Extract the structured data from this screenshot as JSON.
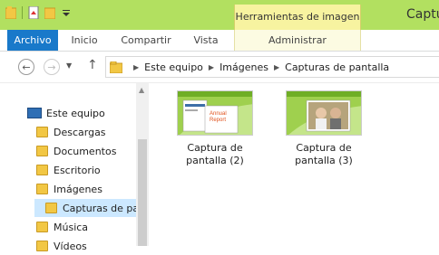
{
  "window": {
    "title": "Captu"
  },
  "quick_access": {
    "icons": [
      "folder-icon",
      "properties-icon",
      "new-folder-icon",
      "customize-dropdown-icon"
    ]
  },
  "ribbon": {
    "contextual_label": "Herramientas de imagen",
    "tabs": [
      {
        "label": "Archivo",
        "active": true
      },
      {
        "label": "Inicio"
      },
      {
        "label": "Compartir"
      },
      {
        "label": "Vista"
      },
      {
        "label": "Administrar"
      }
    ]
  },
  "address": {
    "crumbs": [
      "Este equipo",
      "Imágenes",
      "Capturas de pantalla"
    ]
  },
  "sidebar": {
    "items": [
      {
        "label": "Este equipo",
        "icon": "computer-icon"
      },
      {
        "label": "Descargas",
        "icon": "folder-icon"
      },
      {
        "label": "Documentos",
        "icon": "folder-icon"
      },
      {
        "label": "Escritorio",
        "icon": "folder-icon"
      },
      {
        "label": "Imágenes",
        "icon": "folder-icon"
      },
      {
        "label": "Capturas de pa",
        "icon": "folder-icon",
        "selected": true
      },
      {
        "label": "Música",
        "icon": "folder-icon"
      },
      {
        "label": "Vídeos",
        "icon": "folder-icon"
      }
    ]
  },
  "files": [
    {
      "name_line1": "Captura de",
      "name_line2": "pantalla (2)",
      "thumb_text": [
        "Annual",
        "Report"
      ]
    },
    {
      "name_line1": "Captura de",
      "name_line2": "pantalla (3)"
    }
  ],
  "colors": {
    "titlebar": "#b2e060",
    "file_tab": "#1979ca",
    "contextual": "#f7f3a0",
    "selection": "#cce8ff"
  }
}
